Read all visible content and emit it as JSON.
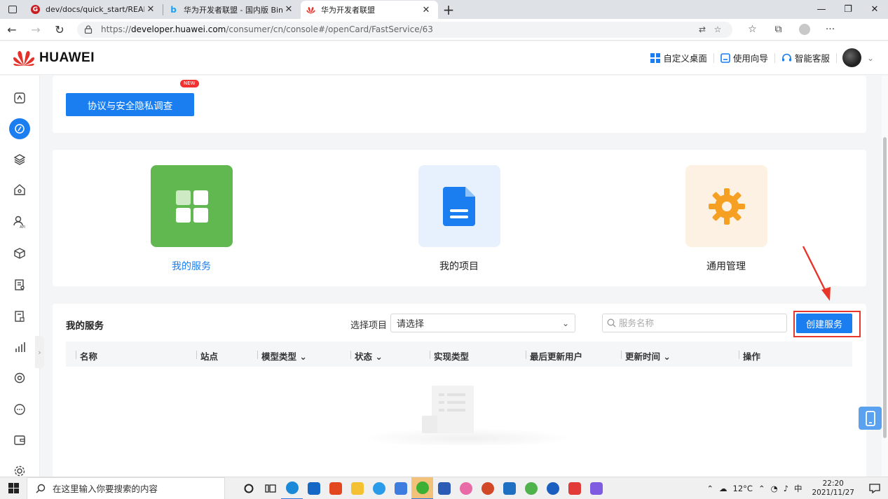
{
  "browser": {
    "tabs": [
      {
        "title": "dev/docs/quick_start/README.m",
        "icon": "gitee-icon",
        "active": false
      },
      {
        "title": "华为开发者联盟 - 国内版 Bing",
        "icon": "bing-icon",
        "active": false
      },
      {
        "title": "华为开发者联盟",
        "icon": "huawei-icon",
        "active": true
      }
    ],
    "url_prefix": "https://",
    "url_domain": "developer.huawei.com",
    "url_path": "/consumer/cn/console#/openCard/FastService/63"
  },
  "header": {
    "brand": "HUAWEI",
    "links": [
      {
        "label": "自定义桌面",
        "icon": "grid-icon"
      },
      {
        "label": "使用向导",
        "icon": "guide-icon"
      },
      {
        "label": "智能客服",
        "icon": "headset-icon"
      }
    ]
  },
  "banner": {
    "survey_label": "协议与安全隐私调查",
    "new_badge": "NEW"
  },
  "tiles": [
    {
      "label": "我的服务",
      "color": "#62b850",
      "label_color": "#1a7ef0"
    },
    {
      "label": "我的项目",
      "color": "#e6f1fd",
      "label_color": "#222222"
    },
    {
      "label": "通用管理",
      "color": "#fdf1e3",
      "label_color": "#222222"
    }
  ],
  "services": {
    "title": "我的服务",
    "project_label": "选择项目",
    "project_placeholder": "请选择",
    "search_placeholder": "服务名称",
    "create_label": "创建服务",
    "columns": [
      "名称",
      "站点",
      "模型类型",
      "状态",
      "实现类型",
      "最后更新用户",
      "更新时间",
      "操作"
    ],
    "rows": []
  },
  "taskbar": {
    "search_placeholder": "在这里输入你要搜索的内容",
    "weather": "12°C",
    "time": "22:20",
    "date": "2021/11/27"
  },
  "colors": {
    "accent": "#1a7ef0",
    "highlight": "#e8362a"
  }
}
